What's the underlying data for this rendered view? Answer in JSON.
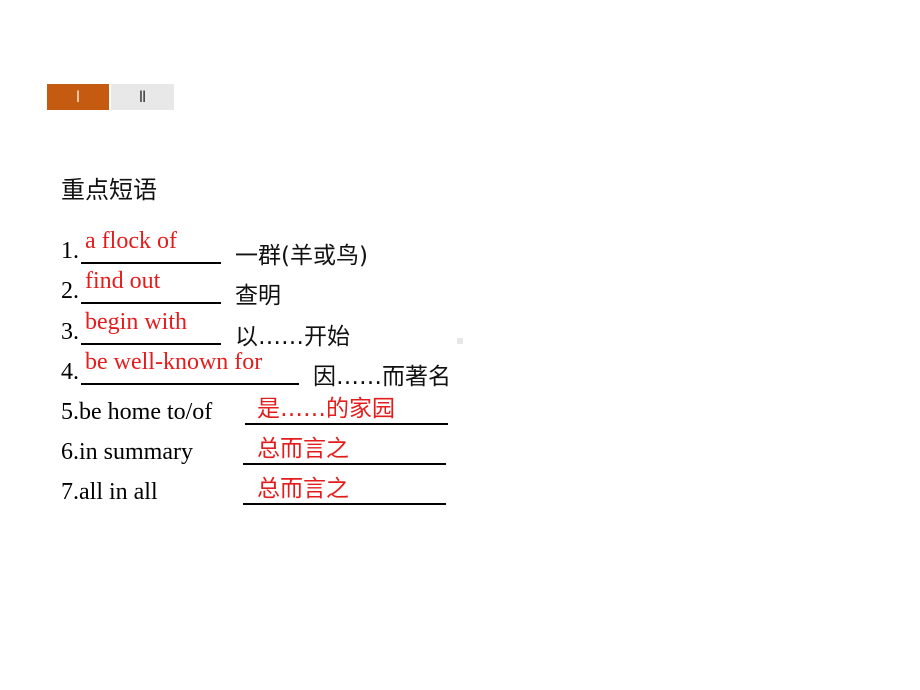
{
  "tabs": [
    {
      "label": "Ⅰ",
      "active": true
    },
    {
      "label": "Ⅱ",
      "active": false
    }
  ],
  "colors": {
    "tab_active": "#c55a11",
    "tab_inactive": "#e8e8e8",
    "answer": "#e51c1c"
  },
  "heading": "重点短语",
  "phrases": [
    {
      "num": "1.",
      "answer": "a flock of",
      "meaning": "一群(羊或鸟)"
    },
    {
      "num": "2.",
      "answer": "find out",
      "meaning": "查明"
    },
    {
      "num": "3.",
      "answer": "begin with",
      "meaning": "以……开始"
    },
    {
      "num": "4.",
      "answer": "be well-known for",
      "meaning": "因……而著名"
    }
  ],
  "translations": [
    {
      "prompt": "5.be home to/of",
      "answer": "是……的家园"
    },
    {
      "prompt": "6.in summary",
      "answer": "总而言之"
    },
    {
      "prompt": "7.all in all",
      "answer": "总而言之"
    }
  ]
}
